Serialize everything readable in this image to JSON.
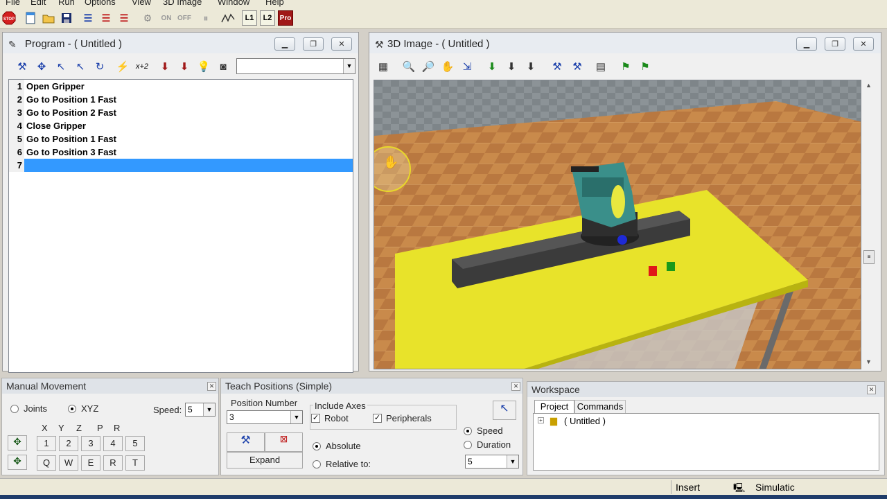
{
  "menu": [
    "File",
    "Edit",
    "Run",
    "Options",
    "View",
    "3D Image",
    "Window",
    "Help"
  ],
  "toolbar": {
    "stop_label": "STOP",
    "on_label": "ON",
    "off_label": "OFF",
    "l1_label": "L1",
    "l2_label": "L2",
    "pro_label": "Pro"
  },
  "program_window": {
    "title": "Program -  ( Untitled )",
    "lines": [
      {
        "num": "1",
        "text": "Open Gripper"
      },
      {
        "num": "2",
        "text": "Go to Position 1 Fast"
      },
      {
        "num": "3",
        "text": "Go to Position 2 Fast"
      },
      {
        "num": "4",
        "text": "Close Gripper"
      },
      {
        "num": "5",
        "text": "Go to Position 1 Fast"
      },
      {
        "num": "6",
        "text": "Go to Position 3 Fast"
      },
      {
        "num": "7",
        "text": ""
      }
    ],
    "toolbar_text": "x+2"
  },
  "image_window": {
    "title": "3D Image -  ( Untitled )"
  },
  "manual_movement": {
    "title": "Manual Movement",
    "joints_label": "Joints",
    "xyz_label": "XYZ",
    "speed_label": "Speed:",
    "speed_value": "5",
    "axes": [
      "X",
      "Y",
      "Z",
      "P",
      "R"
    ],
    "plus_keys": [
      "1",
      "2",
      "3",
      "4",
      "5"
    ],
    "minus_keys": [
      "Q",
      "W",
      "E",
      "R",
      "T"
    ]
  },
  "teach_positions": {
    "title": "Teach Positions (Simple)",
    "position_number_label": "Position Number",
    "position_number_value": "3",
    "expand_label": "Expand",
    "include_axes_label": "Include Axes",
    "robot_label": "Robot",
    "peripherals_label": "Peripherals",
    "absolute_label": "Absolute",
    "relative_label": "Relative to:",
    "speed_label": "Speed",
    "duration_label": "Duration",
    "speed_value": "5"
  },
  "workspace": {
    "title": "Workspace",
    "tabs": [
      "Project",
      "Commands"
    ],
    "tree_root": "( Untitled )"
  },
  "status": {
    "mode": "Insert",
    "sim": "Simulatic"
  },
  "colors": {
    "selection": "#3399ff",
    "table": "#e8e32a",
    "floor": "#c98a4b"
  }
}
